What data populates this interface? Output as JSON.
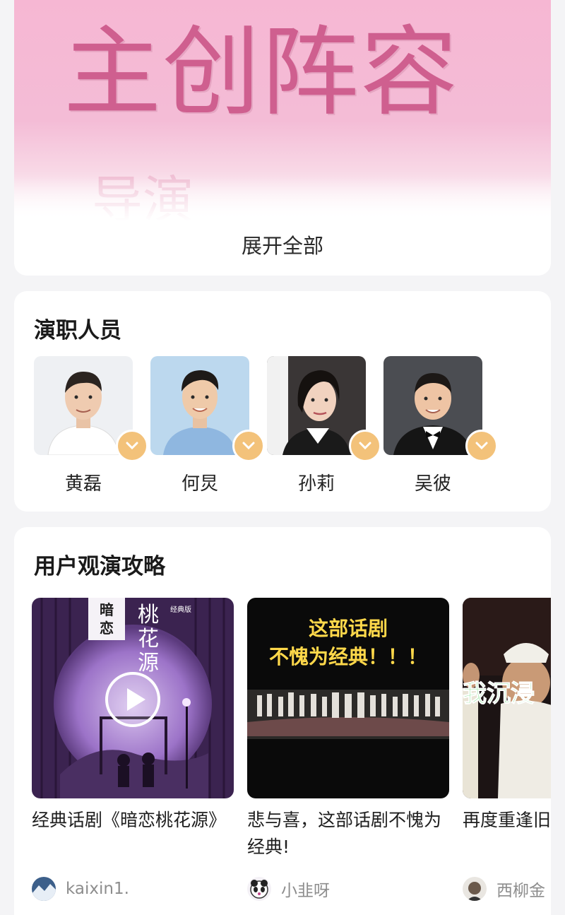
{
  "creative_team": {
    "banner_title": "主创阵容",
    "banner_subtitle": "导演",
    "expand_label": "展开全部"
  },
  "cast": {
    "title": "演职人员",
    "members": [
      {
        "name": "黄磊"
      },
      {
        "name": "何炅"
      },
      {
        "name": "孙莉"
      },
      {
        "name": "吴彼"
      }
    ]
  },
  "guides": {
    "title": "用户观演攻略",
    "items": [
      {
        "title": "经典话剧《暗恋桃花源》",
        "author": "kaixin1.",
        "thumb_text": [
          "暗恋",
          "桃花源",
          "经典版"
        ]
      },
      {
        "title": "悲与喜，这部话剧不愧为经典!",
        "author": "小韭呀",
        "thumb_text": [
          "这部话剧",
          "不愧为经典！！！"
        ]
      },
      {
        "title": "再度重逢旧",
        "author": "西柳金",
        "thumb_text": [
          "我沉浸"
        ]
      }
    ]
  },
  "colors": {
    "banner_pink": "#f6b7d3",
    "banner_title": "#cf5f8f",
    "badge_gold": "#f3c27a",
    "thumb_yellow": "#ffd84a",
    "author_gray": "#8d8d8d"
  }
}
